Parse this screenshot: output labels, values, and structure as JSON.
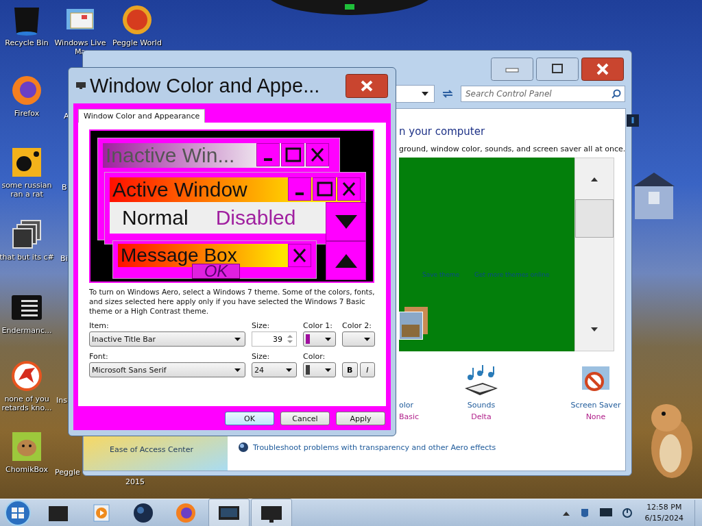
{
  "desktop_icons": [
    {
      "kind": "bin",
      "label": "Recycle Bin"
    },
    {
      "kind": "mail",
      "label": "Windows Live Ma"
    },
    {
      "kind": "ball",
      "label": "Peggle World"
    },
    {
      "kind": "browser",
      "label": "Firefox"
    },
    {
      "kind": "tile",
      "label": "some russian ran a rat"
    },
    {
      "kind": "stack",
      "label": "that but its c#"
    },
    {
      "kind": "terminal",
      "label": "Endermanc..."
    },
    {
      "kind": "dino",
      "label": "none of you retards kno..."
    },
    {
      "kind": "pet",
      "label": "ChomikBox"
    }
  ],
  "partial_labels": [
    "A",
    "B",
    "Bi",
    "Ins",
    "Peggle"
  ],
  "desktop_text": "2015",
  "control_panel": {
    "search": {
      "placeholder": "Search Control Panel"
    },
    "heading": "n your computer",
    "subtitle": "ground, window color, sounds, and screen saver all at once.",
    "theme_links": [
      "Save theme",
      "Get more themes online"
    ],
    "settings": [
      {
        "label": "olor",
        "value": "Basic"
      },
      {
        "label": "Sounds",
        "value": "Delta"
      },
      {
        "label": "Screen Saver",
        "value": "None"
      }
    ],
    "troubleshoot_link": "Troubleshoot problems with transparency and other Aero effects",
    "left_pane_link": "Ease of Access Center"
  },
  "dialog": {
    "title": "Window Color and Appe...",
    "tabs": [
      {
        "label": "Window Color and Appearance",
        "selected": true
      }
    ],
    "preview": {
      "inactive_title": "Inactive Win...",
      "active_title": "Active Window",
      "normal": "Normal",
      "disabled": "Disabled",
      "message_title": "Message Box",
      "ok": "OK"
    },
    "description": "To turn on Windows Aero, select a Windows 7 theme.  Some of the colors, fonts, and sizes selected here apply only if you have selected the Windows 7 Basic theme or a High Contrast theme.",
    "item": {
      "label": "Item:",
      "value": "Inactive Title Bar"
    },
    "item_size": {
      "label": "Size:",
      "value": "39"
    },
    "item_colors": [
      {
        "label": "Color 1:",
        "color": "#a0109f"
      },
      {
        "label": "Color 2:"
      }
    ],
    "font": {
      "label": "Font:",
      "value": "Microsoft Sans Serif"
    },
    "font_size": {
      "label": "Size:",
      "value": "24"
    },
    "font_color": {
      "label": "Color:",
      "color": "#404040"
    },
    "style_buttons": [
      {
        "label": "B",
        "kind": "bold"
      },
      {
        "label": "I",
        "kind": "italic"
      }
    ],
    "buttons": [
      "OK",
      "Cancel",
      "Apply"
    ]
  },
  "taskbar": {
    "time": "12:58 PM",
    "date": "6/15/2024"
  }
}
